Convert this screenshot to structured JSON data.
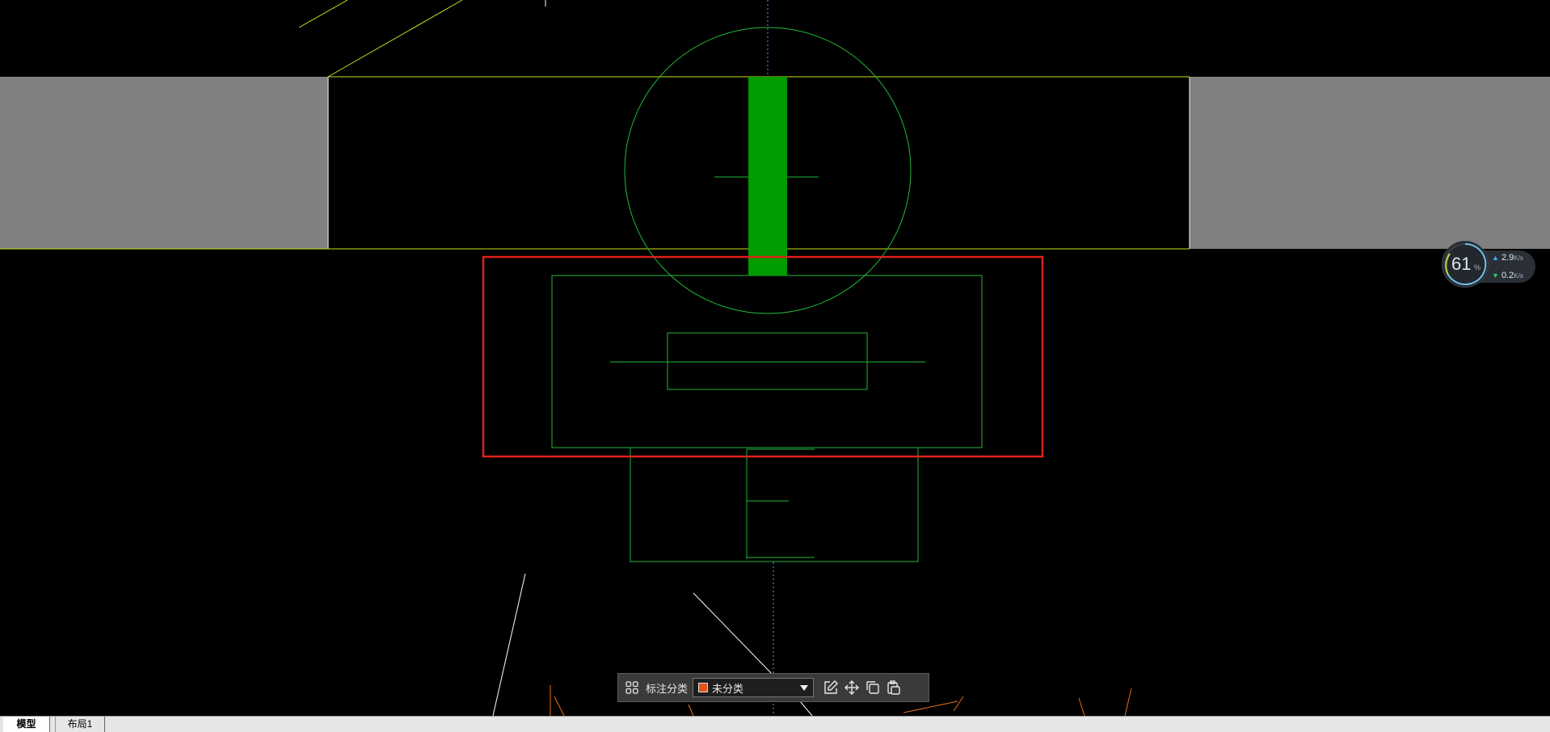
{
  "annotation_toolbar": {
    "label": "标注分类",
    "category_selected": "未分类",
    "category_color": "#e8501a",
    "icons": [
      "layout-grid-icon",
      "edit-icon",
      "move-icon",
      "copy-icon",
      "paste-icon"
    ]
  },
  "tabs": [
    {
      "label": "模型",
      "active": true
    },
    {
      "label": "布局1",
      "active": false
    }
  ],
  "network_monitor": {
    "percent": "61",
    "percent_unit": "%",
    "upload": "2.9",
    "upload_unit": "K/s",
    "download": "0.2",
    "download_unit": "K/s",
    "upload_color": "#3fa9f5",
    "download_color": "#34c759"
  },
  "colors": {
    "background": "#000000",
    "highlight_box": "#e0201a",
    "green_lines": "#1fb83a",
    "yellow_lines": "#c8e01e",
    "gray_fill": "#808080",
    "orange_lines": "#e8701a"
  }
}
